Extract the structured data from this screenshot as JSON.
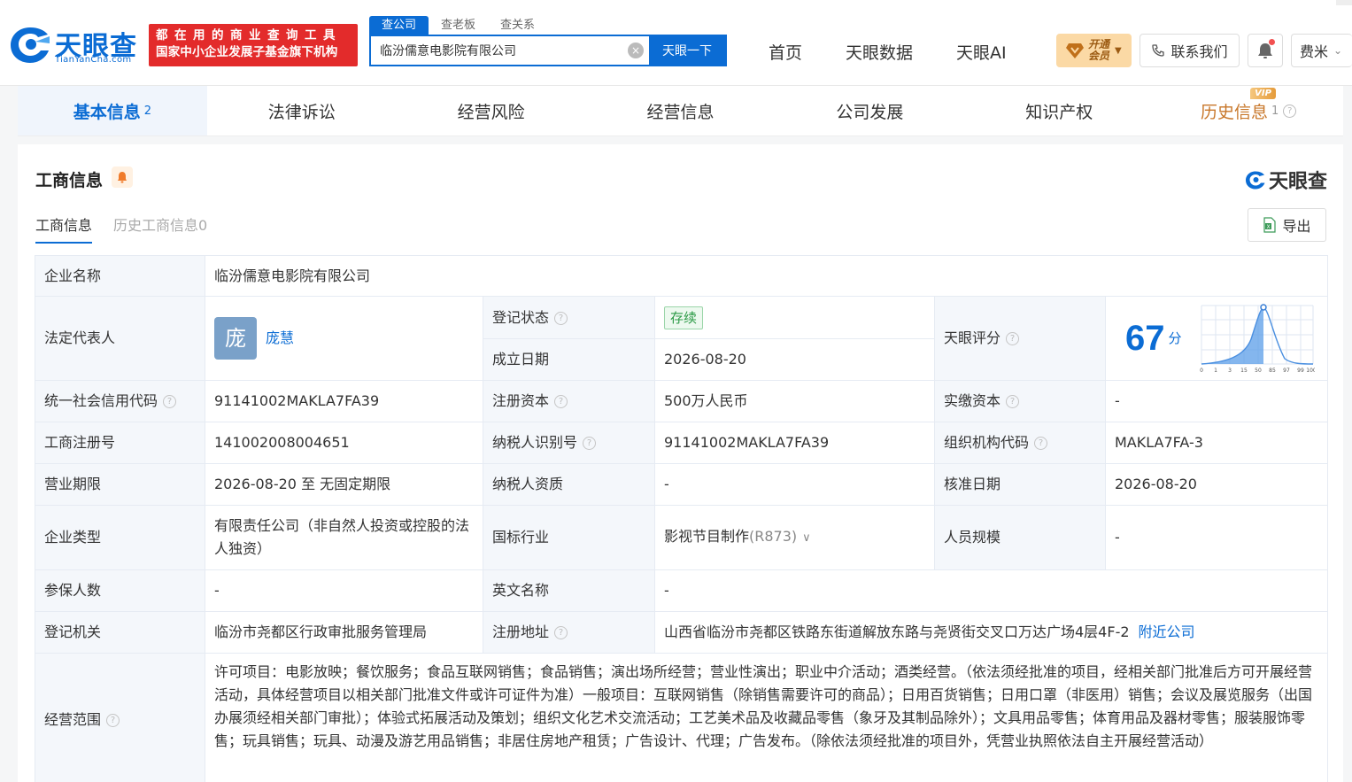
{
  "header": {
    "logo_text": "天眼查",
    "logo_sub": "TianYanCha.com",
    "banner_line1": "都在用的商业查询工具",
    "banner_line2": "国家中小企业发展子基金旗下机构",
    "search_tabs": [
      "查公司",
      "查老板",
      "查关系"
    ],
    "search_value": "临汾儒意电影院有限公司",
    "search_button": "天眼一下",
    "nav": [
      "首页",
      "天眼数据",
      "天眼AI"
    ],
    "vip_label": "开通会员",
    "contact_label": "联系我们",
    "user_label": "费米"
  },
  "tabs": [
    {
      "label": "基本信息",
      "count": "2"
    },
    {
      "label": "法律诉讼",
      "count": ""
    },
    {
      "label": "经营风险",
      "count": ""
    },
    {
      "label": "经营信息",
      "count": ""
    },
    {
      "label": "公司发展",
      "count": ""
    },
    {
      "label": "知识产权",
      "count": ""
    },
    {
      "label": "历史信息",
      "count": "1",
      "badge": "VIP"
    }
  ],
  "section": {
    "title": "工商信息",
    "brand": "天眼查",
    "subtabs": [
      "工商信息",
      "历史工商信息0"
    ],
    "export_label": "导出"
  },
  "company": {
    "name_label": "企业名称",
    "name": "临汾儒意电影院有限公司",
    "legal_rep_label": "法定代表人",
    "legal_rep_avatar": "庞",
    "legal_rep": "庞慧",
    "status_label": "登记状态",
    "status": "存续",
    "founded_label": "成立日期",
    "founded": "2026-08-20",
    "score_label": "天眼评分",
    "score": "67",
    "score_unit": "分",
    "score_axis": [
      "0",
      "1",
      "3",
      "15",
      "50",
      "85",
      "97",
      "99",
      "100"
    ],
    "credit_code_label": "统一社会信用代码",
    "credit_code": "91141002MAKLA7FA39",
    "reg_capital_label": "注册资本",
    "reg_capital": "500万人民币",
    "paid_capital_label": "实缴资本",
    "paid_capital": "-",
    "reg_no_label": "工商注册号",
    "reg_no": "141002008004651",
    "taxpayer_id_label": "纳税人识别号",
    "taxpayer_id": "91141002MAKLA7FA39",
    "org_code_label": "组织机构代码",
    "org_code": "MAKLA7FA-3",
    "term_label": "营业期限",
    "term": "2026-08-20 至 无固定期限",
    "taxpayer_qual_label": "纳税人资质",
    "taxpayer_qual": "-",
    "approval_date_label": "核准日期",
    "approval_date": "2026-08-20",
    "type_label": "企业类型",
    "type": "有限责任公司（非自然人投资或控股的法人独资）",
    "industry_label": "国标行业",
    "industry": "影视节目制作",
    "industry_code": "(R873)",
    "staff_size_label": "人员规模",
    "staff_size": "-",
    "insured_label": "参保人数",
    "insured": "-",
    "english_name_label": "英文名称",
    "english_name": "-",
    "authority_label": "登记机关",
    "authority": "临汾市尧都区行政审批服务管理局",
    "address_label": "注册地址",
    "address": "山西省临汾市尧都区铁路东街道解放东路与尧贤街交叉口万达广场4层4F-2",
    "nearby_link": "附近公司",
    "scope_label": "经营范围",
    "scope": "许可项目：电影放映；餐饮服务；食品互联网销售；食品销售；演出场所经营；营业性演出；职业中介活动；酒类经营。（依法须经批准的项目，经相关部门批准后方可开展经营活动，具体经营项目以相关部门批准文件或许可证件为准）一般项目：互联网销售（除销售需要许可的商品）；日用百货销售；日用口罩（非医用）销售；会议及展览服务（出国办展须经相关部门审批）；体验式拓展活动及策划；组织文化艺术交流活动；工艺美术品及收藏品零售（象牙及其制品除外）；文具用品零售；体育用品及器材零售；服装服饰零售；玩具销售；玩具、动漫及游艺用品销售；非居住房地产租赁；广告设计、代理；广告发布。（除依法须经批准的项目外，凭营业执照依法自主开展经营活动）"
  },
  "colors": {
    "brand_blue": "#0b6cd4",
    "banner_red": "#e32b2b",
    "vip_gold": "#fbd9a5",
    "status_green": "#2c9a46"
  }
}
